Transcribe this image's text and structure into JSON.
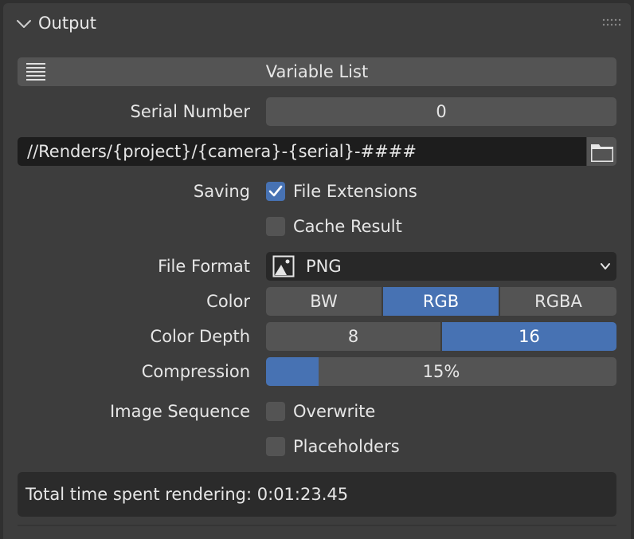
{
  "panel": {
    "title": "Output"
  },
  "variable_list": {
    "label": "Variable List"
  },
  "serial_number": {
    "label": "Serial Number",
    "value": "0"
  },
  "output_path": {
    "value": "//Renders/{project}/{camera}-{serial}-####"
  },
  "saving": {
    "label": "Saving",
    "file_extensions": {
      "label": "File Extensions",
      "checked": true
    },
    "cache_result": {
      "label": "Cache Result",
      "checked": false
    }
  },
  "file_format": {
    "label": "File Format",
    "value": "PNG"
  },
  "color": {
    "label": "Color",
    "options": [
      "BW",
      "RGB",
      "RGBA"
    ],
    "selected": "RGB"
  },
  "color_depth": {
    "label": "Color Depth",
    "options": [
      "8",
      "16"
    ],
    "selected": "16"
  },
  "compression": {
    "label": "Compression",
    "value_text": "15%",
    "value": 15
  },
  "image_sequence": {
    "label": "Image Sequence",
    "overwrite": {
      "label": "Overwrite",
      "checked": false
    },
    "placeholders": {
      "label": "Placeholders",
      "checked": false
    }
  },
  "render_time": {
    "text": "Total time spent rendering: 0:01:23.45"
  },
  "colors": {
    "accent": "#4772b3",
    "panel_bg": "#3d3d3d",
    "widget_bg": "#545454",
    "field_bg": "#1d1d1d"
  }
}
